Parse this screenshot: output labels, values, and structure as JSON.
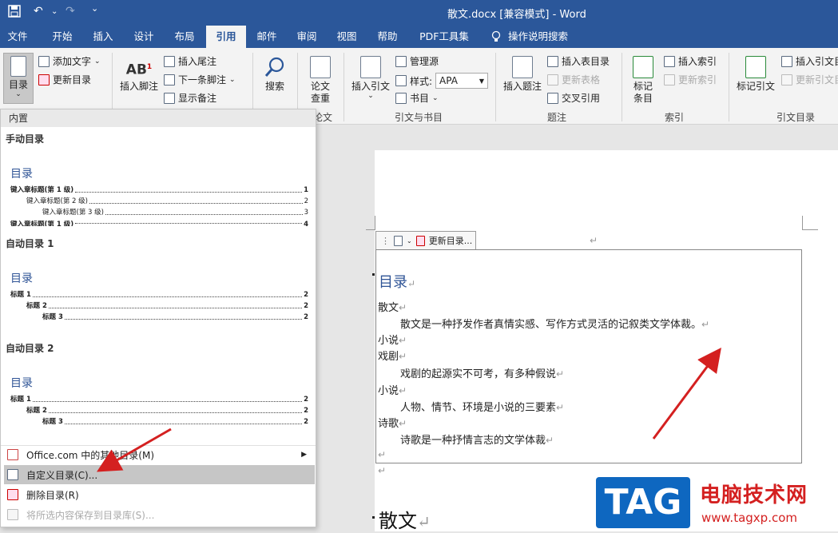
{
  "titlebar": {
    "title": "散文.docx [兼容模式]  -  Word",
    "undo_glyph": "↶",
    "redo_glyph": "↷",
    "customize_glyph": "⌄"
  },
  "tabs": [
    {
      "label": "文件"
    },
    {
      "label": "开始"
    },
    {
      "label": "插入"
    },
    {
      "label": "设计"
    },
    {
      "label": "布局"
    },
    {
      "label": "引用",
      "active": true
    },
    {
      "label": "邮件"
    },
    {
      "label": "审阅"
    },
    {
      "label": "视图"
    },
    {
      "label": "帮助"
    },
    {
      "label": "PDF工具集"
    },
    {
      "label": "操作说明搜索"
    }
  ],
  "ribbon": {
    "toc_button": "目录",
    "add_text": "添加文字",
    "update_toc": "更新目录",
    "insert_footnote": "插入脚注",
    "insert_endnote": "插入尾注",
    "next_footnote": "下一条脚注",
    "show_notes": "显示备注",
    "search": "搜索",
    "paper_check_1": "论文",
    "paper_check_2": "查重",
    "paper_group": "论文",
    "insert_citation": "插入引文",
    "manage_sources": "管理源",
    "style_label": "样式:",
    "style_value": "APA",
    "bibliography": "书目",
    "citations_group": "引文与书目",
    "insert_caption": "插入题注",
    "insert_table_of_figures": "插入表目录",
    "update_table": "更新表格",
    "cross_reference": "交叉引用",
    "captions_group": "题注",
    "mark_entry_1": "标记",
    "mark_entry_2": "条目",
    "insert_index": "插入索引",
    "update_index": "更新索引",
    "index_group": "索引",
    "mark_citation": "标记引文",
    "insert_toa": "插入引文目",
    "update_toa": "更新引文目",
    "toa_group": "引文目录"
  },
  "dropdown": {
    "header": "内置",
    "manual": {
      "label": "手动目录",
      "title": "目录",
      "lines": [
        {
          "text": "键入章标题(第 1 级)",
          "page": "1"
        },
        {
          "text": "键入章标题(第 2 级)",
          "page": "2"
        },
        {
          "text": "键入章标题(第 3 级)",
          "page": "3"
        },
        {
          "text": "键入章标题(第 1 级)",
          "page": "4"
        }
      ]
    },
    "auto1": {
      "label": "自动目录 1",
      "title": "目录",
      "lines": [
        {
          "text": "标题 1",
          "page": "2"
        },
        {
          "text": "标题 2",
          "page": "2"
        },
        {
          "text": "标题 3",
          "page": "2"
        }
      ]
    },
    "auto2": {
      "label": "自动目录 2",
      "title": "目录",
      "lines": [
        {
          "text": "标题 1",
          "page": "2"
        },
        {
          "text": "标题 2",
          "page": "2"
        },
        {
          "text": "标题 3",
          "page": "2"
        }
      ]
    },
    "menu": {
      "more_office": "Office.com 中的其他目录(M)",
      "custom_toc": "自定义目录(C)...",
      "remove_toc": "删除目录(R)",
      "save_selection": "将所选内容保存到目录库(S)..."
    }
  },
  "document": {
    "toc_control_label": "更新目录...",
    "toc_title": "目录",
    "lines": [
      {
        "text": "散文",
        "indent": false
      },
      {
        "text": "散文是一种抒发作者真情实感、写作方式灵活的记叙类文学体裁。",
        "indent": true
      },
      {
        "text": "小说",
        "indent": false
      },
      {
        "text": "戏剧",
        "indent": false
      },
      {
        "text": "戏剧的起源实不可考，有多种假说",
        "indent": true
      },
      {
        "text": "小说",
        "indent": false
      },
      {
        "text": "人物、情节、环境是小说的三要素",
        "indent": true
      },
      {
        "text": "诗歌",
        "indent": false
      },
      {
        "text": "诗歌是一种抒情言志的文学体裁",
        "indent": true
      }
    ],
    "heading": "散文",
    "para_mark": "↵"
  },
  "watermark": {
    "tag": "TAG",
    "name": "电脑技术网",
    "url": "www.tagxp.com"
  },
  "colors": {
    "word_blue": "#2b579a",
    "heading_blue": "#2f5496",
    "arrow_red": "#d42020"
  }
}
